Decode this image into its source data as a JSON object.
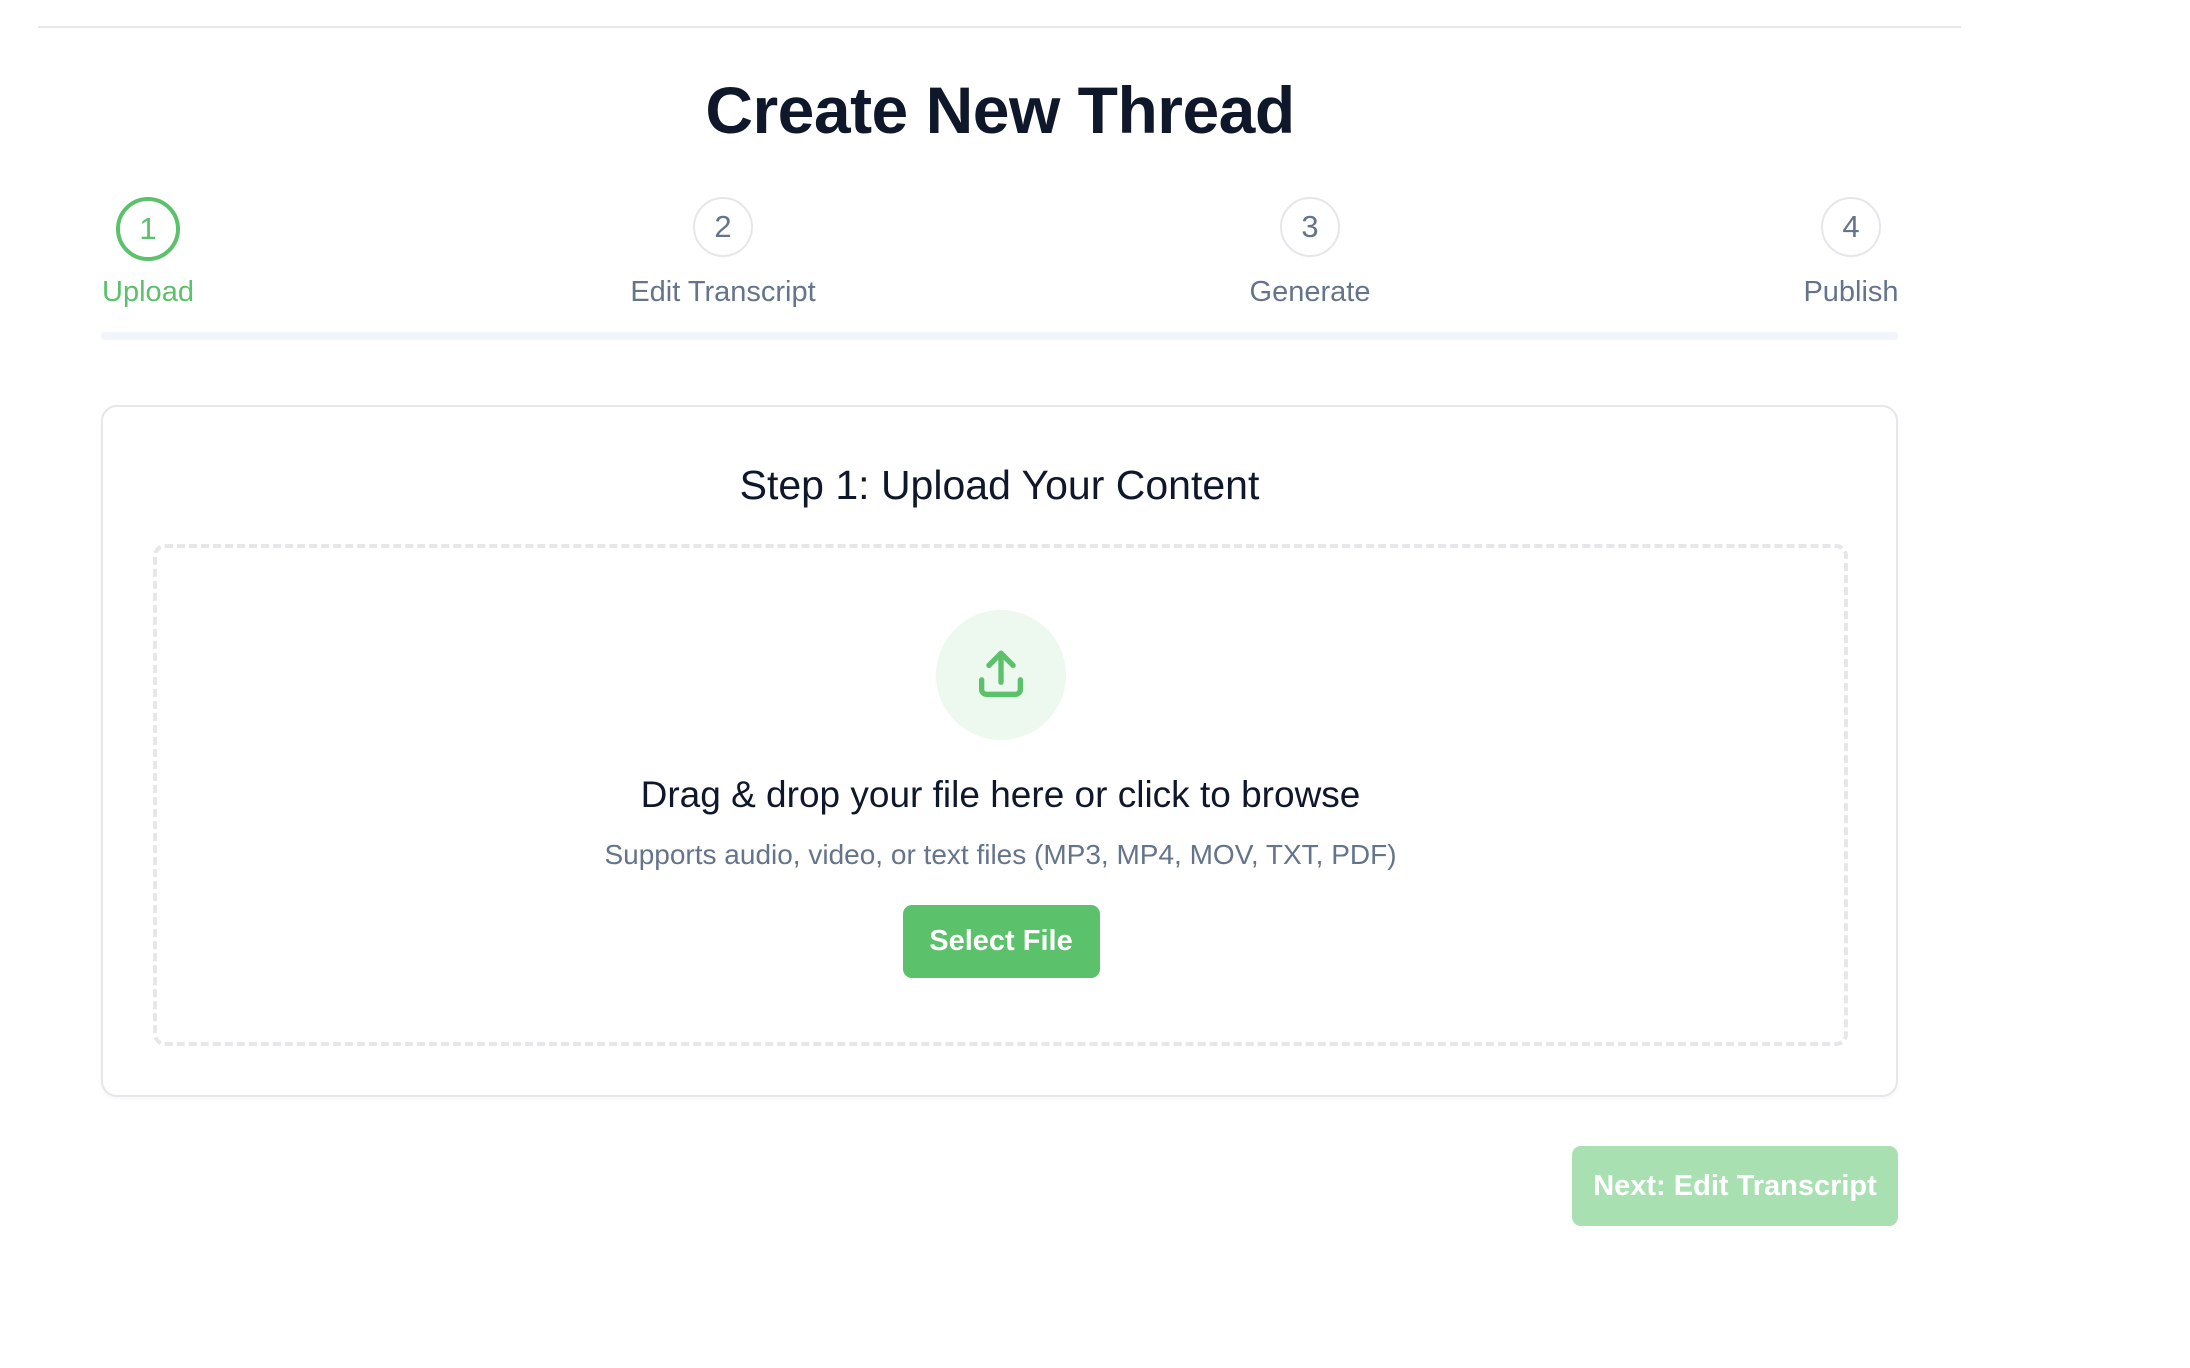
{
  "page": {
    "title": "Create New Thread"
  },
  "stepper": {
    "active_step": 1,
    "accent_color": "#5bc16a",
    "steps": [
      {
        "number": "1",
        "label": "Upload"
      },
      {
        "number": "2",
        "label": "Edit Transcript"
      },
      {
        "number": "3",
        "label": "Generate"
      },
      {
        "number": "4",
        "label": "Publish"
      }
    ]
  },
  "card": {
    "title": "Step 1: Upload Your Content"
  },
  "dropzone": {
    "icon": "upload-icon",
    "title": "Drag & drop your file here or click to browse",
    "subtitle": "Supports audio, video, or text files (MP3, MP4, MOV, TXT, PDF)",
    "select_label": "Select File"
  },
  "footer": {
    "next_label": "Next: Edit Transcript",
    "next_disabled": true
  }
}
